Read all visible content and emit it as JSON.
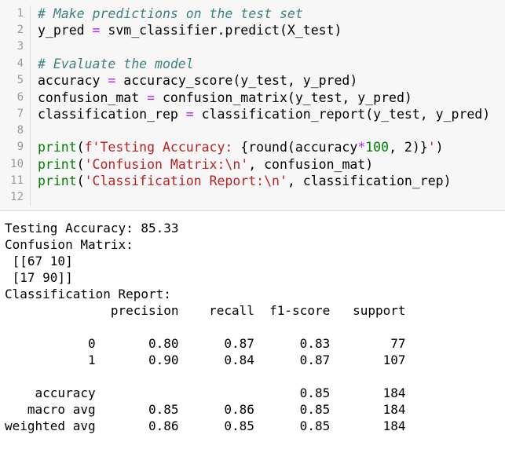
{
  "code": {
    "line_numbers": [
      "1",
      "2",
      "3",
      "4",
      "5",
      "6",
      "7",
      "8",
      "9",
      "10",
      "11",
      "12"
    ],
    "l1": "# Make predictions on the test set",
    "l2": {
      "a": "y_pred ",
      "op": "=",
      "b": " svm_classifier.predict(X_test)"
    },
    "l4": "# Evaluate the model",
    "l5": {
      "a": "accuracy ",
      "op": "=",
      "b": " accuracy_score(y_test, y_pred)"
    },
    "l6": {
      "a": "confusion_mat ",
      "op": "=",
      "b": " confusion_matrix(y_test, y_pred)"
    },
    "l7": {
      "a": "classification_rep ",
      "op": "=",
      "b": " classification_report(y_test, y_pred)"
    },
    "l9": {
      "fn": "print",
      "p1": "(",
      "str1": "f'Testing Accuracy: ",
      "brace": "{round(accuracy",
      "op": "*",
      "num": "100",
      "rest": ", 2)}",
      "str2": "'",
      "close": ")"
    },
    "l10": {
      "fn": "print",
      "p1": "(",
      "str": "'Confusion Matrix:\\n'",
      "rest": ", confusion_mat)"
    },
    "l11": {
      "fn": "print",
      "p1": "(",
      "str": "'Classification Report:\\n'",
      "rest": ", classification_rep)"
    }
  },
  "output": {
    "lines": [
      "Testing Accuracy: 85.33",
      "Confusion Matrix:",
      " [[67 10]",
      " [17 90]]",
      "Classification Report:",
      "              precision    recall  f1-score   support",
      "",
      "           0       0.80      0.87      0.83        77",
      "           1       0.90      0.84      0.87       107",
      "",
      "    accuracy                           0.85       184",
      "   macro avg       0.85      0.86      0.85       184",
      "weighted avg       0.86      0.85      0.85       184"
    ]
  }
}
